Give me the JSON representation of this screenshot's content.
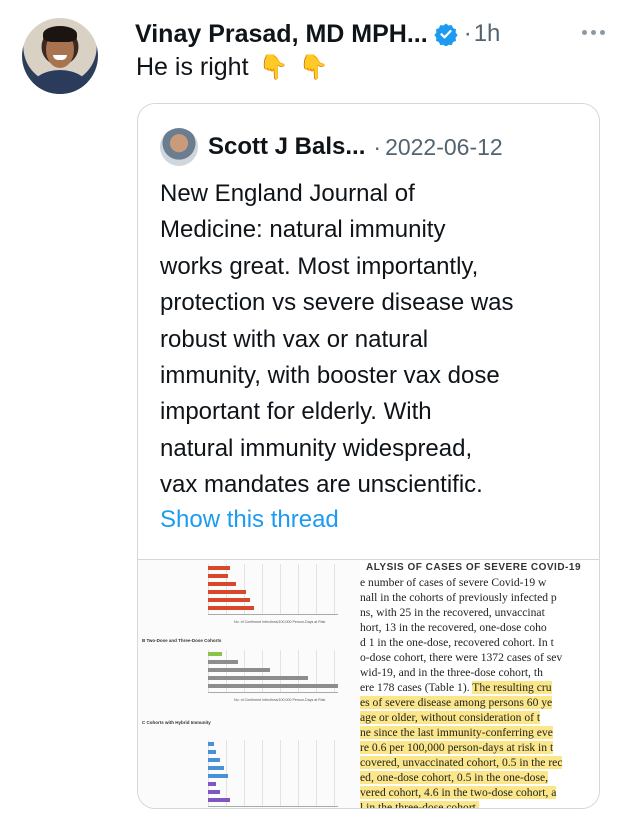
{
  "tweet": {
    "author": "Vinay Prasad, MD MPH...",
    "separator": "·",
    "time": "1h",
    "text": "He is right",
    "emojis": [
      "👇",
      "👇"
    ]
  },
  "quote": {
    "author": "Scott J Bals...",
    "separator": "·",
    "date": "2022-06-12",
    "lines": [
      "New England Journal of",
      "Medicine: natural immunity",
      "works great. Most importantly,",
      "protection vs severe disease was",
      "robust with vax or natural",
      "immunity, with booster vax dose",
      "important for elderly. With",
      "natural immunity widespread,",
      "vax mandates are unscientific."
    ],
    "show_thread": "Show this thread"
  },
  "media": {
    "panel_b_title": "B  Two-Dose and Three-Dose Cohorts",
    "panel_c_title": "C  Cohorts with Hybrid Immunity",
    "axis_label": "No. of Confirmed Infections/100,000 Person-Days at Risk",
    "doc_heading": "ALYSIS OF CASES OF SEVERE COVID-19",
    "doc_lines": [
      "e number of cases of severe Covid-19 w",
      "nall in the cohorts of previously infected p",
      "ns, with 25 in the recovered, unvaccinat",
      "hort, 13 in the recovered, one-dose coho",
      "d 1 in the one-dose, recovered cohort. In t",
      "o-dose cohort, there were 1372 cases of sev",
      "wid-19, and in the three-dose cohort, th",
      "ere 178 cases (Table 1). The resulting cru",
      "es of severe disease among persons 60 ye",
      " age or older, without consideration of t",
      "ne since the last immunity-conferring eve",
      "re 0.6 per 100,000 person-days at risk in t",
      "covered, unvaccinated cohort, 0.5 in the rec",
      "ed, one-dose cohort, 0.5 in the one-dose, ",
      "vered cohort, 4.6 in the two-dose cohort, a",
      "l in the three-dose cohort."
    ],
    "doc_highlight_from": 7,
    "colors": {
      "red": "#d9472b",
      "green": "#8bc34a",
      "gray": "#8d8d8d",
      "blue": "#4a90d9",
      "purple": "#7e57c2",
      "highlight": "#fbe78a"
    }
  }
}
